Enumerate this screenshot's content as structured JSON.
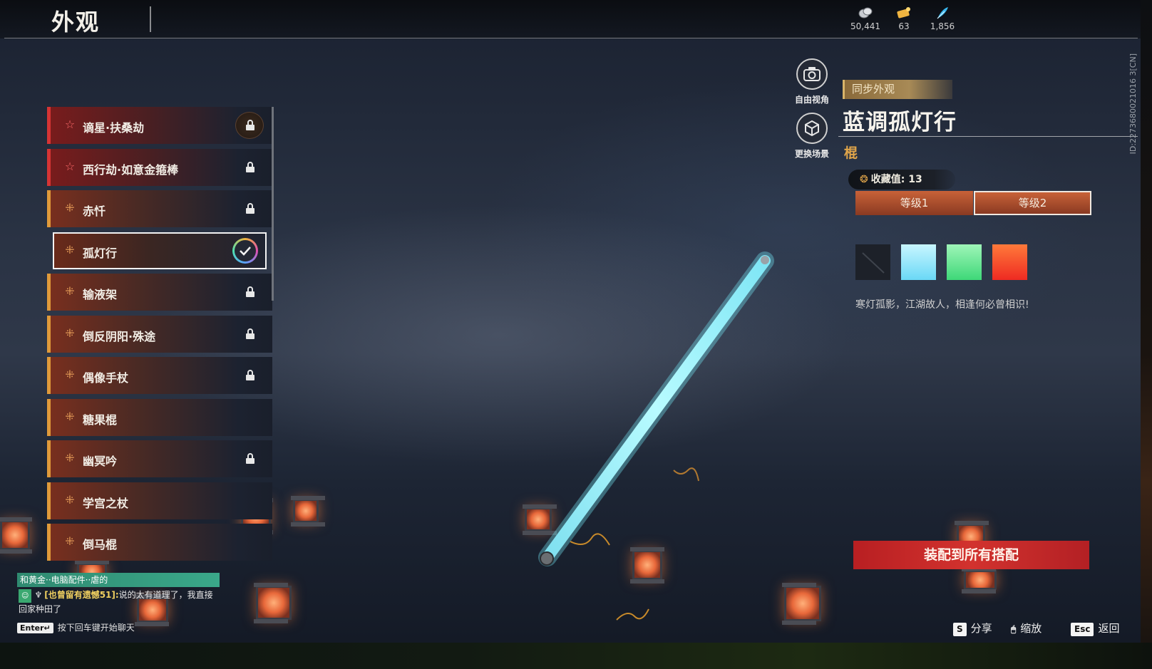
{
  "header": {
    "title": "外观",
    "currencies": [
      {
        "icon": "silver-coin-icon",
        "value": "50,441"
      },
      {
        "icon": "gold-ticket-icon",
        "value": "63"
      },
      {
        "icon": "feather-icon",
        "value": "1,856"
      }
    ]
  },
  "list": {
    "items": [
      {
        "label": "谪星·扶桑劫",
        "tier": "rare",
        "status": "locked"
      },
      {
        "label": "西行劫·如意金箍棒",
        "tier": "rare",
        "status": "locked"
      },
      {
        "label": "赤忏",
        "tier": "epic",
        "status": "locked"
      },
      {
        "label": "孤灯行",
        "tier": "epic",
        "status": "equipped"
      },
      {
        "label": "输液架",
        "tier": "epic",
        "status": "locked"
      },
      {
        "label": "倒反阴阳·殊途",
        "tier": "epic",
        "status": "locked"
      },
      {
        "label": "偶像手杖",
        "tier": "epic",
        "status": "locked"
      },
      {
        "label": "糖果棍",
        "tier": "epic",
        "status": "unlocked"
      },
      {
        "label": "幽冥吟",
        "tier": "epic",
        "status": "locked"
      },
      {
        "label": "学宫之杖",
        "tier": "epic",
        "status": "unlocked"
      },
      {
        "label": "倒马棍",
        "tier": "epic",
        "status": "unlocked"
      }
    ]
  },
  "tools": {
    "free_view": "自由视角",
    "change_scene": "更换场景"
  },
  "detail": {
    "sync_tag": "同步外观",
    "name": "蓝调孤灯行",
    "type": "棍",
    "collect_label": "收藏值: 13",
    "levels": [
      "等级1",
      "等级2"
    ],
    "selected_level": "等级2",
    "swatches": [
      {
        "name": "none",
        "color": "#1d2129"
      },
      {
        "name": "cyan",
        "color": "#8fe6ff"
      },
      {
        "name": "green",
        "color": "#5fe88c"
      },
      {
        "name": "red-orange",
        "color": "#f5452a"
      }
    ],
    "flavor": "寒灯孤影，江湖故人，相逢何必曾相识!",
    "equip_button": "装配到所有搭配",
    "side_id": "ID:2273680021016 3[CN]"
  },
  "chat": {
    "top_line": "和黄金··电脑配件··虐的",
    "sender": "[也曾留有遗憾51]:",
    "message": "说的太有道理了，我直接回家种田了",
    "enter_key": "Enter↵",
    "hint": "按下回车键开始聊天"
  },
  "hotkeys": [
    {
      "key": "S",
      "label": "分享"
    },
    {
      "key": "🖱",
      "label": "缩放"
    },
    {
      "key": "Esc",
      "label": "返回"
    }
  ],
  "colors": {
    "accent_orange": "#e09a3a",
    "rare_red": "#d63434",
    "equip_red": "#c82a2a",
    "staff_cyan": "#8ff0ff"
  }
}
